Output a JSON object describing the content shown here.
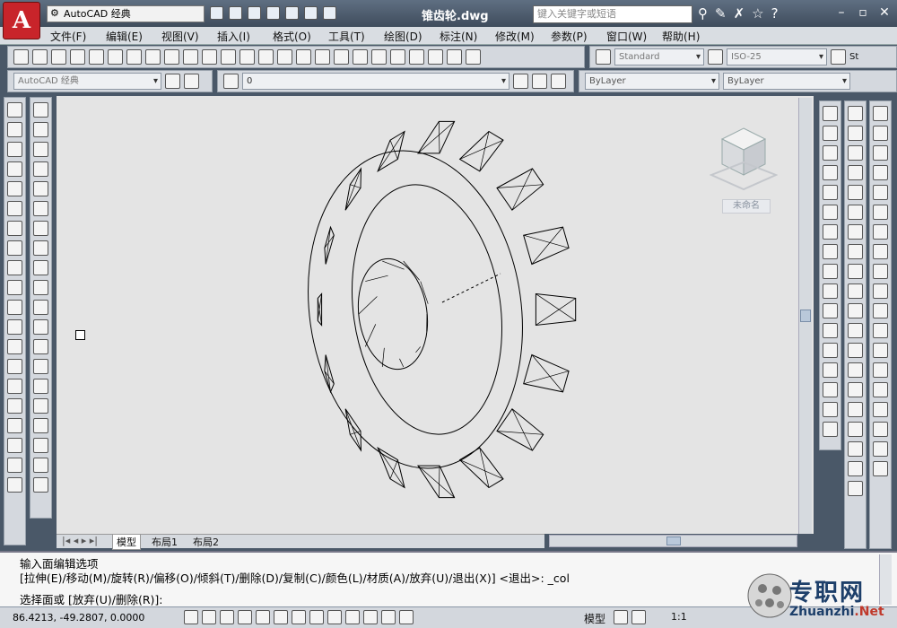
{
  "app": {
    "menu_button": "A"
  },
  "workspace": {
    "name": "AutoCAD 经典"
  },
  "document": {
    "title": "锥齿轮.dwg"
  },
  "search": {
    "placeholder": "键入关键字或短语"
  },
  "menu": [
    "文件(F)",
    "编辑(E)",
    "视图(V)",
    "插入(I)",
    "格式(O)",
    "工具(T)",
    "绘图(D)",
    "标注(N)",
    "修改(M)",
    "参数(P)",
    "窗口(W)",
    "帮助(H)"
  ],
  "styles": {
    "text_style": "Standard",
    "dim_style": "ISO-25",
    "table_style_partial": "St"
  },
  "layers": {
    "workspace_combo": "AutoCAD 经典",
    "current_layer": "0",
    "color": "ByLayer",
    "linetype": "ByLayer"
  },
  "viewcube": {
    "label": "未命名"
  },
  "layout_tabs": [
    "模型",
    "布局1",
    "布局2"
  ],
  "command": {
    "history_1": "输入面编辑选项",
    "history_2": "[拉伸(E)/移动(M)/旋转(R)/偏移(O)/倾斜(T)/删除(D)/复制(C)/颜色(L)/材质(A)/放弃(U)/退出(X)] <退出>: _col",
    "prompt": "选择面或 [放弃(U)/删除(R)]:"
  },
  "status": {
    "coordinates": "86.4213,  -49.2807, 0.0000",
    "space": "模型",
    "scale": "1:1"
  },
  "watermark": {
    "cn": "专职网",
    "en_1": "Zhuanzhi",
    "en_2": ".Net"
  },
  "colors": {
    "app_red": "#c8242a",
    "title_bar": "#4a5868",
    "canvas": "#e4e4e4",
    "ribbon": "#d4d8de"
  }
}
